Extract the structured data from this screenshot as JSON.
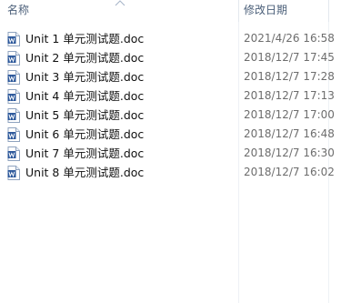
{
  "columns": {
    "name": "名称",
    "date_modified": "修改日期"
  },
  "files": [
    {
      "name": "Unit 1 单元测试题.doc",
      "date": "2021/4/26 16:58",
      "icon": "word-doc-icon"
    },
    {
      "name": "Unit 2 单元测试题.doc",
      "date": "2018/12/7 17:45",
      "icon": "word-doc-icon"
    },
    {
      "name": "Unit 3 单元测试题.doc",
      "date": "2018/12/7 17:28",
      "icon": "word-doc-icon"
    },
    {
      "name": "Unit 4 单元测试题.doc",
      "date": "2018/12/7 17:13",
      "icon": "word-doc-icon"
    },
    {
      "name": "Unit 5 单元测试题.doc",
      "date": "2018/12/7 17:00",
      "icon": "word-doc-icon"
    },
    {
      "name": "Unit 6 单元测试题.doc",
      "date": "2018/12/7 16:48",
      "icon": "word-doc-icon"
    },
    {
      "name": "Unit 7 单元测试题.doc",
      "date": "2018/12/7 16:30",
      "icon": "word-doc-icon"
    },
    {
      "name": "Unit 8 单元测试题.doc",
      "date": "2018/12/7 16:02",
      "icon": "word-doc-icon"
    }
  ],
  "colors": {
    "header_text": "#4c607a",
    "icon_blue": "#2b579a",
    "date_text": "#6d6d6d"
  }
}
